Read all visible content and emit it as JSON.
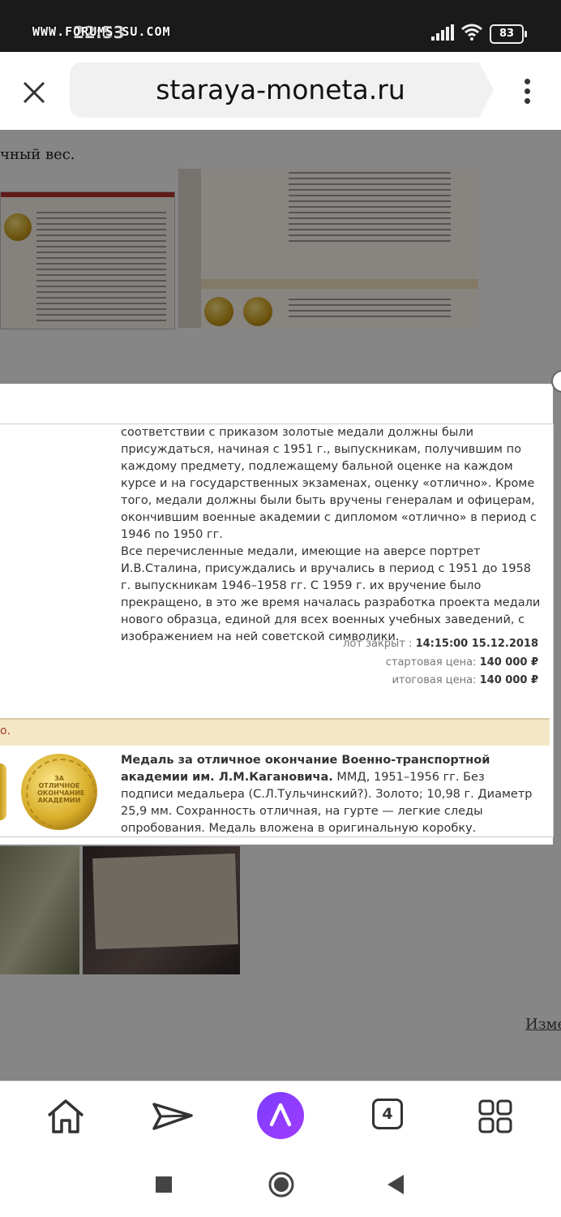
{
  "status_bar": {
    "time": "22:53",
    "watermark": "WWW.FORUMS-SU.COM",
    "battery": "83"
  },
  "browser": {
    "url": "staraya-moneta.ru",
    "tabs_count": "4"
  },
  "page": {
    "top_fragment": "чный вес.",
    "lower_link": "Изме"
  },
  "popup": {
    "description_paragraphs": [
      "соответствии с приказом золотые медали должны были присуждаться, начиная с 1951 г., выпускникам, получившим по каждому предмету, подлежащему бальной оценке на каждом курсе и на государственных экзаменах, оценку «отлично». Кроме того, медали должны были быть вручены генералам и офицерам, окончившим военные академии с дипломом «отлично» в период с 1946 по 1950 гг.",
      "Все перечисленные медали, имеющие на аверсе портрет И.В.Сталина, присуждались и вручались в период с 1951 до 1958 г. выпускникам 1946–1958 гг. С 1959 г. их вручение было прекращено, в это же время началась разработка проекта медали нового образца, единой для всех военных учебных заведений, с изображением на ней советской символики."
    ],
    "lot_closed_label": "лот закрыт :",
    "lot_closed_value": "14:15:00 15.12.2018",
    "start_price_label": "стартовая цена:",
    "start_price_value": "140 000 ₽",
    "final_price_label": "итоговая цена:",
    "final_price_value": "140 000 ₽",
    "next_lot_band_text": "о.",
    "next_lot_title": "Медаль за отличное окончание Военно-транспортной академии им. Л.М.Кагановича.",
    "next_lot_text": " ММД, 1951–1956 гг. Без подписи медальера (С.Л.Тульчинский?). Золото; 10,98 г. Диаметр 25,9 мм. Сохранность отличная, на гурте — легкие следы опробования. Медаль вложена в оригинальную коробку. Довольно редкая.",
    "coin_text": "ЗА ОТЛИЧНОЕ ОКОНЧАНИЕ АКАДЕМИИ"
  },
  "icons": {
    "close": "close-icon",
    "menu": "more-vertical-icon",
    "home": "home-icon",
    "send": "paper-plane-icon",
    "alice": "alice-assistant-icon",
    "tabs": "tabs-icon",
    "grid": "apps-grid-icon"
  },
  "colors": {
    "lot_band": "#f4e7c6",
    "alice_purple": "#8a3cff",
    "lot_number_red": "#a73a2a"
  }
}
